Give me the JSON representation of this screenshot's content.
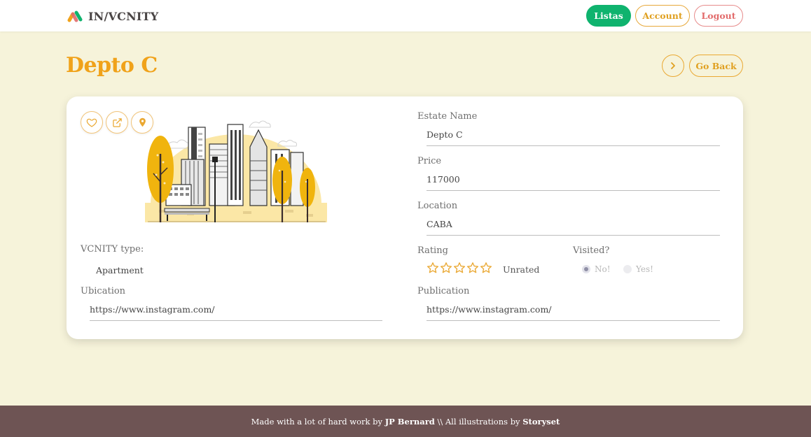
{
  "navbar": {
    "brand": "IN/VCNITY",
    "listas_label": "Listas",
    "account_label": "Account",
    "logout_label": "Logout"
  },
  "page": {
    "title": "Depto C",
    "go_back_label": "Go Back"
  },
  "card": {
    "actions": [
      "heart-icon",
      "external-link-icon",
      "map-pin-icon"
    ],
    "vcnity_type_label": "VCNITY type:",
    "vcnity_type_value": "Apartment",
    "ubication_label": "Ubication",
    "ubication_value": "https://www.instagram.com/",
    "estate_name_label": "Estate Name",
    "estate_name_value": "Depto C",
    "price_label": "Price",
    "price_value": "117000",
    "location_label": "Location",
    "location_value": "CABA",
    "rating_label": "Rating",
    "rating_value": 0,
    "rating_max": 5,
    "rating_text": "Unrated",
    "visited_label": "Visited?",
    "visited_no": "No!",
    "visited_yes": "Yes!",
    "visited_selected": "No!",
    "publication_label": "Publication",
    "publication_value": "https://www.instagram.com/"
  },
  "footer": {
    "prefix": "Made with a lot of hard work by ",
    "author": "JP Bernard",
    "middle": " \\\\ All illustrations by ",
    "credit": "Storyset"
  },
  "colors": {
    "background": "#f6f3da",
    "accent": "#f0a21a",
    "listas_green": "#0fb36e",
    "logout_red": "#e26b6b",
    "footer": "#6e5454"
  }
}
